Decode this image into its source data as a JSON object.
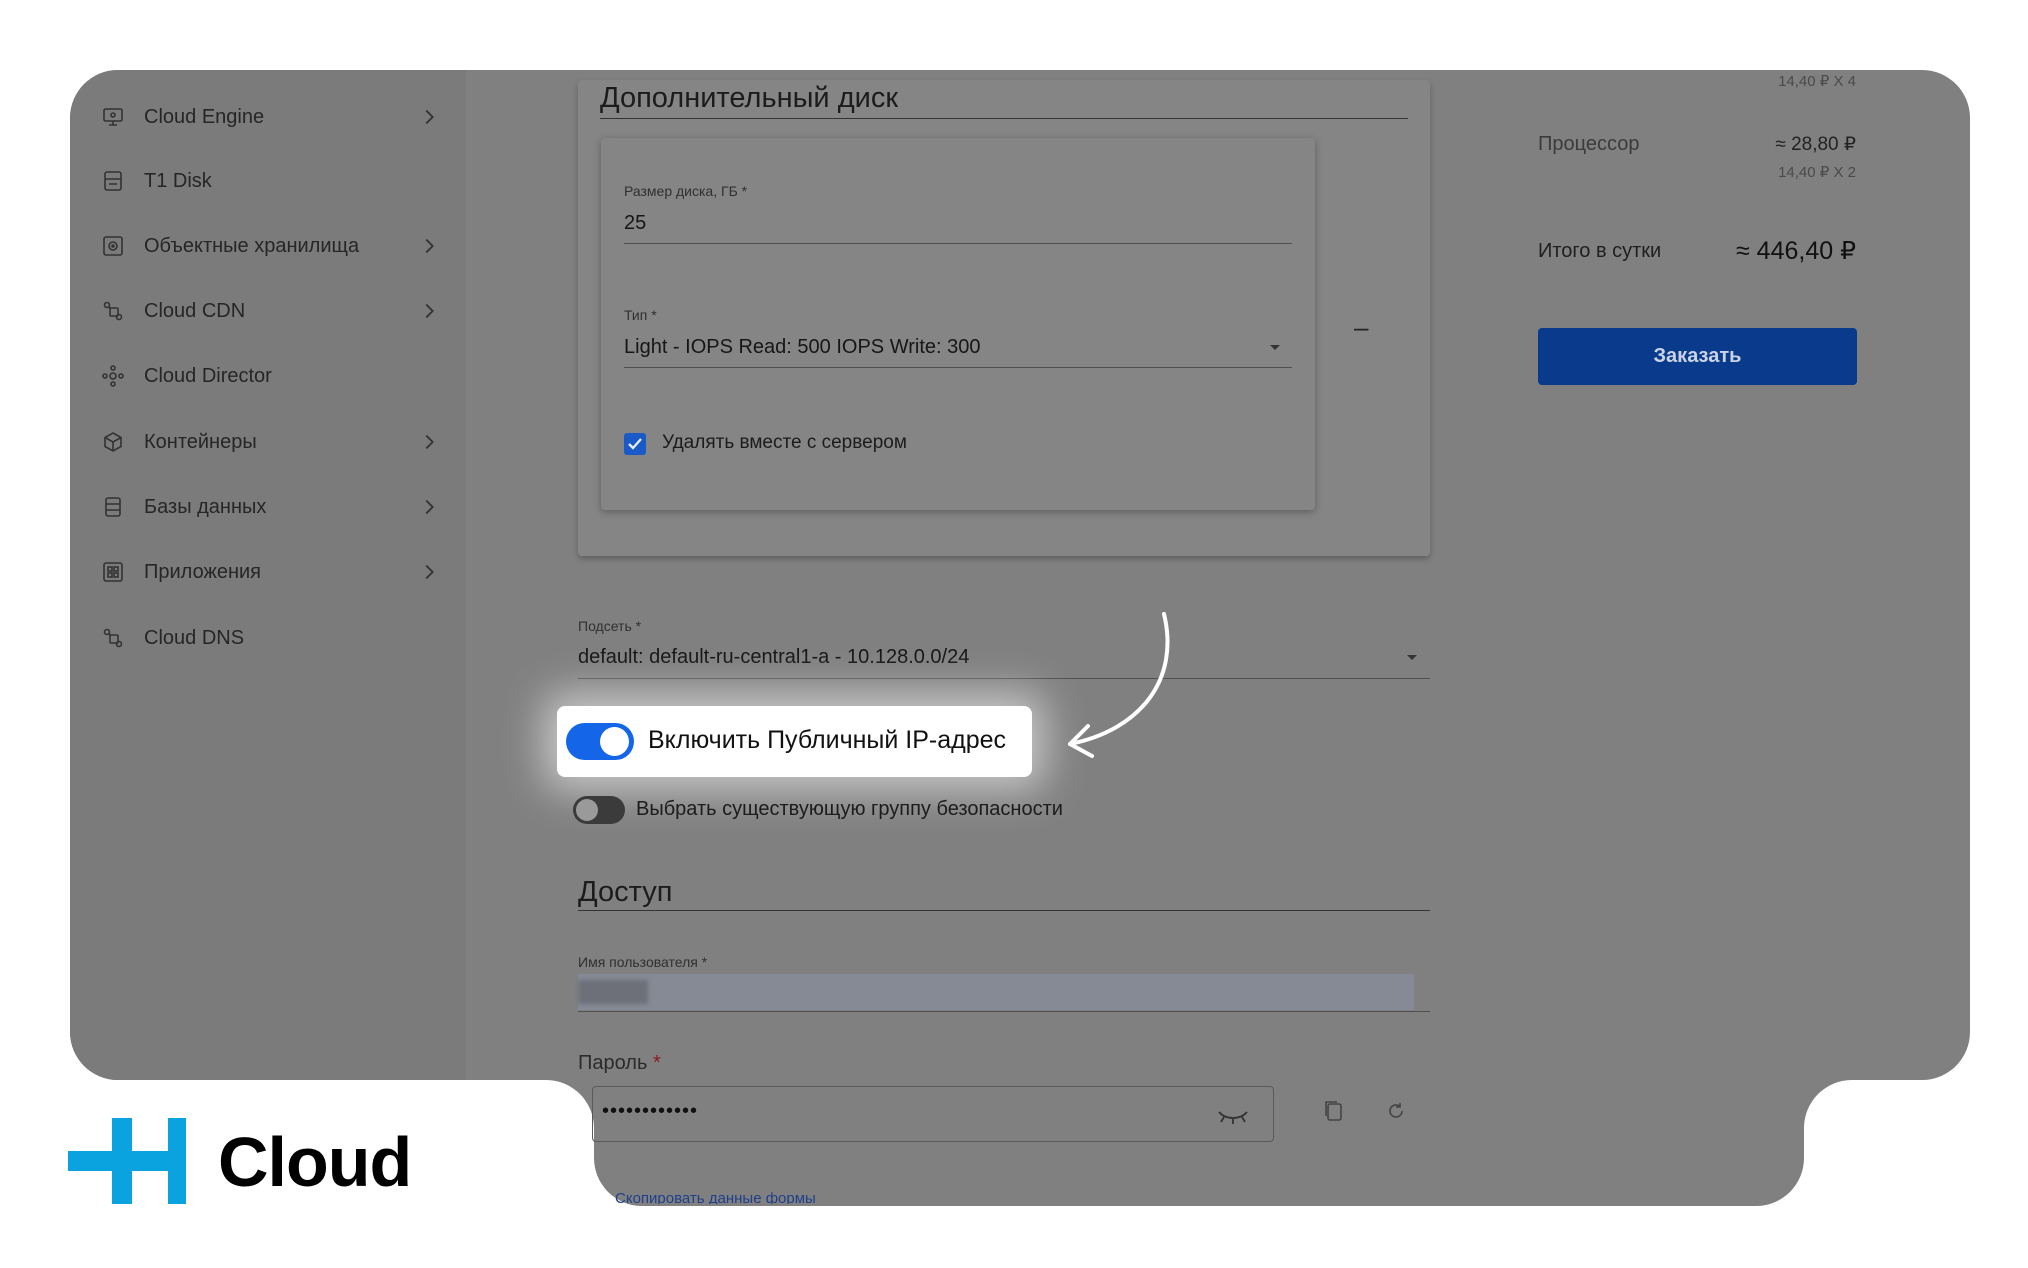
{
  "sidebar": {
    "items": [
      {
        "label": "Cloud Engine",
        "icon": "monitor-icon",
        "chevron": true
      },
      {
        "label": "T1 Disk",
        "icon": "disk-icon",
        "chevron": false
      },
      {
        "label": "Объектные хранилища",
        "icon": "storage-icon",
        "chevron": true
      },
      {
        "label": "Cloud CDN",
        "icon": "network-icon",
        "chevron": true
      },
      {
        "label": "Cloud Director",
        "icon": "director-icon",
        "chevron": false
      },
      {
        "label": "Контейнеры",
        "icon": "cube-icon",
        "chevron": true
      },
      {
        "label": "Базы данных",
        "icon": "database-icon",
        "chevron": true
      },
      {
        "label": "Приложения",
        "icon": "apps-icon",
        "chevron": true
      },
      {
        "label": "Cloud DNS",
        "icon": "network-icon",
        "chevron": false
      }
    ]
  },
  "disk": {
    "title": "Дополнительный диск",
    "size_label": "Размер диска, ГБ *",
    "size_value": "25",
    "type_label": "Тип *",
    "type_value": "Light - IOPS Read: 500 IOPS Write: 300",
    "delete_checkbox_label": "Удалять вместе с сервером",
    "delete_checked": true,
    "remove_symbol": "–"
  },
  "network": {
    "subnet_label": "Подсеть *",
    "subnet_value": "default: default-ru-central1-a - 10.128.0.0/24",
    "public_ip_label": "Включить Публичный IP-адрес",
    "public_ip_enabled": true,
    "security_group_label": "Выбрать существующую группу безопасности",
    "security_group_enabled": false
  },
  "access": {
    "title": "Доступ",
    "username_label": "Имя пользователя *",
    "password_label": "Пароль",
    "password_required_mark": "*",
    "password_value": "••••••••••••",
    "copy_link": "Скопировать данные формы"
  },
  "summary": {
    "top_sub": "14,40 ₽ X 4",
    "cpu_label": "Процессор",
    "cpu_value": "≈ 28,80 ₽",
    "cpu_sub": "14,40 ₽ X 2",
    "total_label": "Итого в сутки",
    "total_value": "≈ 446,40 ₽",
    "order_button": "Заказать"
  },
  "brand": {
    "name": "Cloud",
    "accent": "#0aa3e0"
  },
  "colors": {
    "dim_overlay": "#808080",
    "sidebar_bg": "#7c7c7c",
    "toggle_on": "#1565e8",
    "button_bg": "#0a3a8c"
  }
}
